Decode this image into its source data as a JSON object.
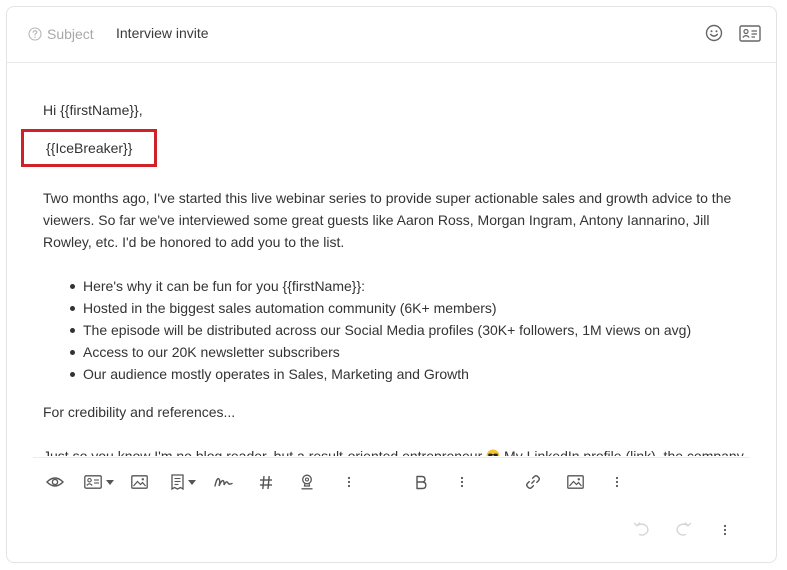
{
  "subject": {
    "label": "Subject",
    "value": "Interview invite"
  },
  "body": {
    "greeting": "Hi {{firstName}},",
    "icebreaker": "{{IceBreaker}}",
    "intro": "Two months ago, I've started this live webinar series to provide super actionable sales and growth advice to the viewers. So far we've interviewed some great guests like Aaron Ross, Morgan Ingram, Antony Iannarino, Jill Rowley, etc. I'd be honored to add you to the list.",
    "bullets": [
      "Here's why it can be fun for you {{firstName}}:",
      "Hosted in the biggest sales automation community (6K+ members)",
      "The episode will be distributed across our Social Media profiles (30K+ followers, 1M views on avg)",
      "Access to our 20K newsletter subscribers",
      "Our audience mostly operates in Sales, Marketing and Growth"
    ],
    "credibility": "For credibility and references...",
    "linkedin_before": "Just so you know I'm no blog reader, but a result-oriented entrepreneur",
    "linkedin_after": "My LinkedIn profile (link), the company"
  },
  "colors": {
    "highlight_border": "#d0202a",
    "icon": "#555555",
    "icon_disabled": "#d6d6d6"
  },
  "icons": {
    "subject_help": "question-circle-icon",
    "emoji": "smiley-icon",
    "contact": "contact-card-icon",
    "toolbar": [
      "eye-icon",
      "contact-card-icon",
      "image-icon",
      "template-icon",
      "signature-icon",
      "hashtag-icon",
      "stamp-icon",
      "more-icon",
      "bold-icon",
      "more-icon",
      "link-icon",
      "image-icon",
      "more-icon"
    ],
    "footer": [
      "undo-icon",
      "redo-icon",
      "more-icon"
    ]
  }
}
